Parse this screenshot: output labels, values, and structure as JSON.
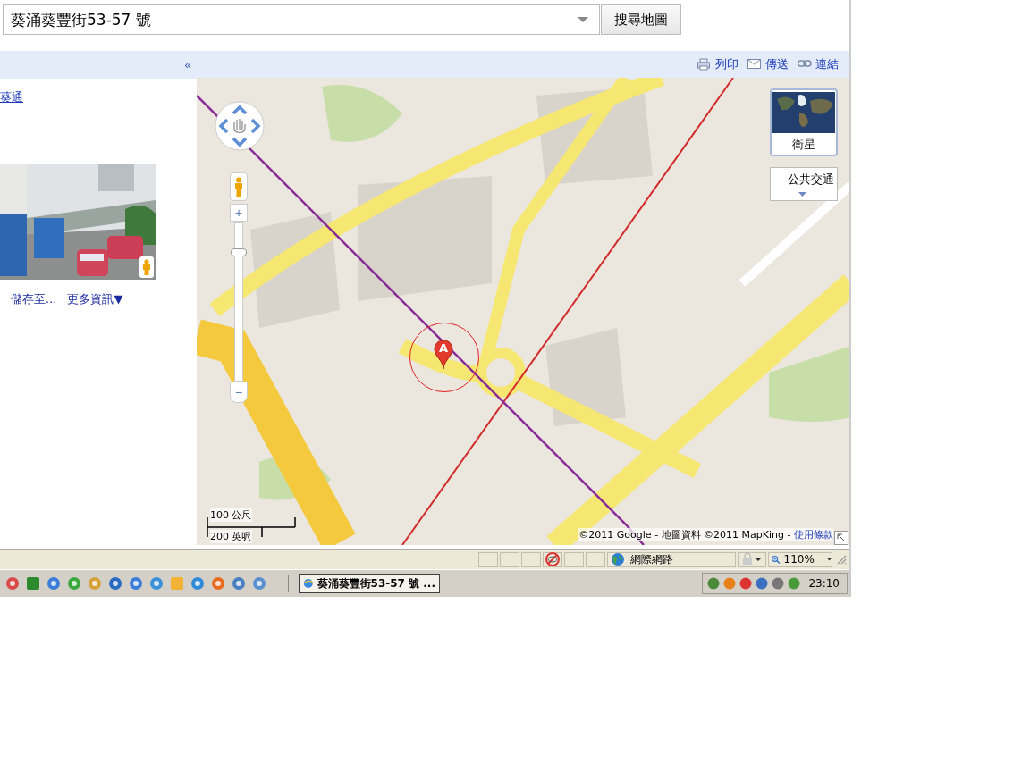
{
  "search": {
    "value": "葵涌葵豐街53-57 號",
    "button": "搜尋地圖"
  },
  "left_panel": {
    "collapse": "«",
    "link": "葵通",
    "photo": {
      "kind": "picture"
    },
    "actions": [
      "儲存至...",
      "更多資訊▼"
    ]
  },
  "map_toolbar": {
    "actions": [
      {
        "kind": "print",
        "label": "列印"
      },
      {
        "kind": "mail",
        "label": "傳送"
      },
      {
        "kind": "link",
        "label": "連結"
      }
    ]
  },
  "map": {
    "kind": "picture",
    "marker": "A",
    "zoom": {
      "in_label": "+",
      "level": 0.83,
      "out_label": "−"
    },
    "map_type": "衛星",
    "layer_dropdown": "公共交通",
    "scale": [
      "100 公尺",
      "200 英呎"
    ],
    "copyright": "©2011 Google - 地圖資料 ©2011 MapKing - ",
    "terms_link": "使用條款"
  },
  "status_bar": {
    "zone": "網際網路",
    "zoom": "110%"
  },
  "taskbar": {
    "tasks": [
      {
        "label": "葵涌葵豐街53-57 號 ...",
        "selected": true
      }
    ],
    "clock": "23:10"
  }
}
